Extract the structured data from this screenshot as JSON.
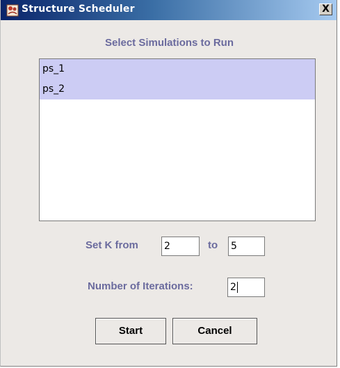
{
  "window": {
    "title": "Structure Scheduler",
    "close_label": "X"
  },
  "header": {
    "label": "Select Simulations to Run"
  },
  "simulations": {
    "items": [
      "ps_1",
      "ps_2"
    ]
  },
  "k_range": {
    "label_from": "Set K from",
    "from_value": "2",
    "label_to": "to",
    "to_value": "5"
  },
  "iterations": {
    "label": "Number of Iterations:",
    "value": "2"
  },
  "buttons": {
    "start": "Start",
    "cancel": "Cancel"
  },
  "colors": {
    "label": "#6b6b9e",
    "selection": "#ccccf4",
    "title_gradient_start": "#0a246a",
    "title_gradient_end": "#a6caf0"
  }
}
